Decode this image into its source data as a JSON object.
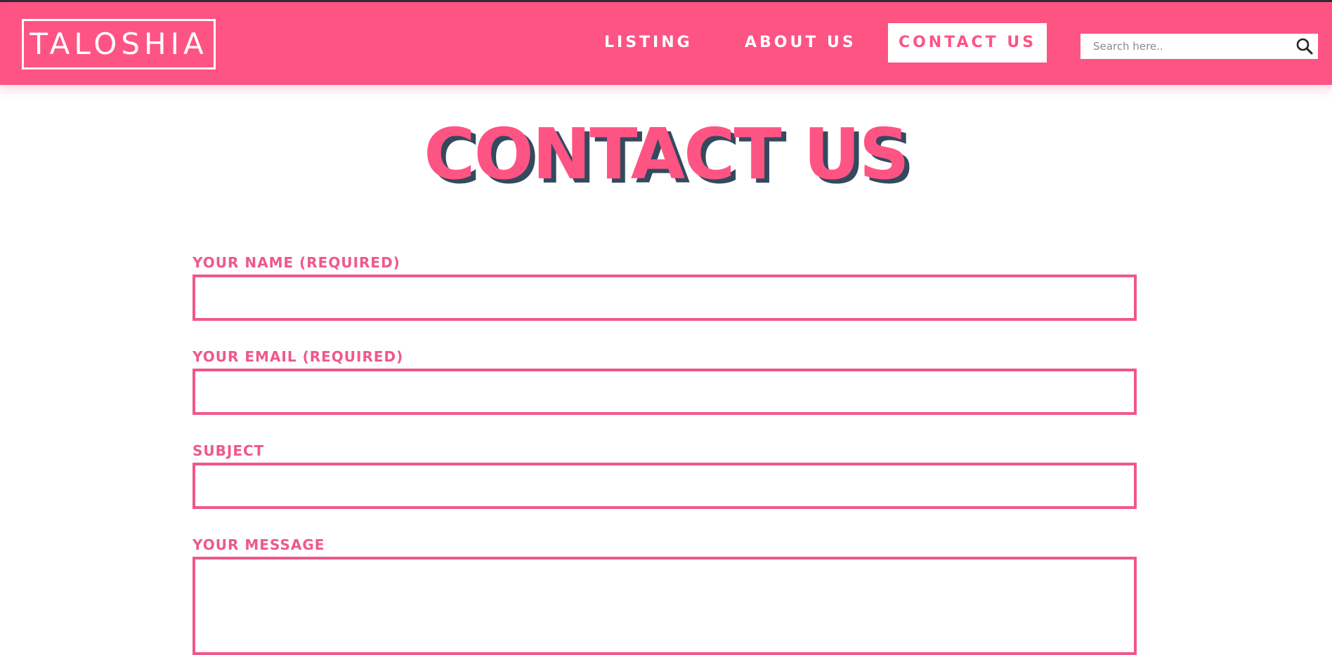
{
  "header": {
    "logo_text": "TALOSHIA",
    "nav": {
      "listing": "LISTING",
      "about": "ABOUT US",
      "contact": "CONTACT US"
    },
    "search": {
      "placeholder": "Search here..",
      "value": ""
    }
  },
  "main": {
    "title": "CONTACT US",
    "form": {
      "name_label": "YOUR NAME (REQUIRED)",
      "name_value": "",
      "email_label": "YOUR EMAIL (REQUIRED)",
      "email_value": "",
      "subject_label": "SUBJECT",
      "subject_value": "",
      "message_label": "YOUR MESSAGE",
      "message_value": ""
    }
  },
  "colors": {
    "brand_pink": "#fe5484",
    "form_pink": "#f0588a",
    "title_shadow": "#34495e"
  },
  "icons": {
    "search": "search-icon"
  }
}
